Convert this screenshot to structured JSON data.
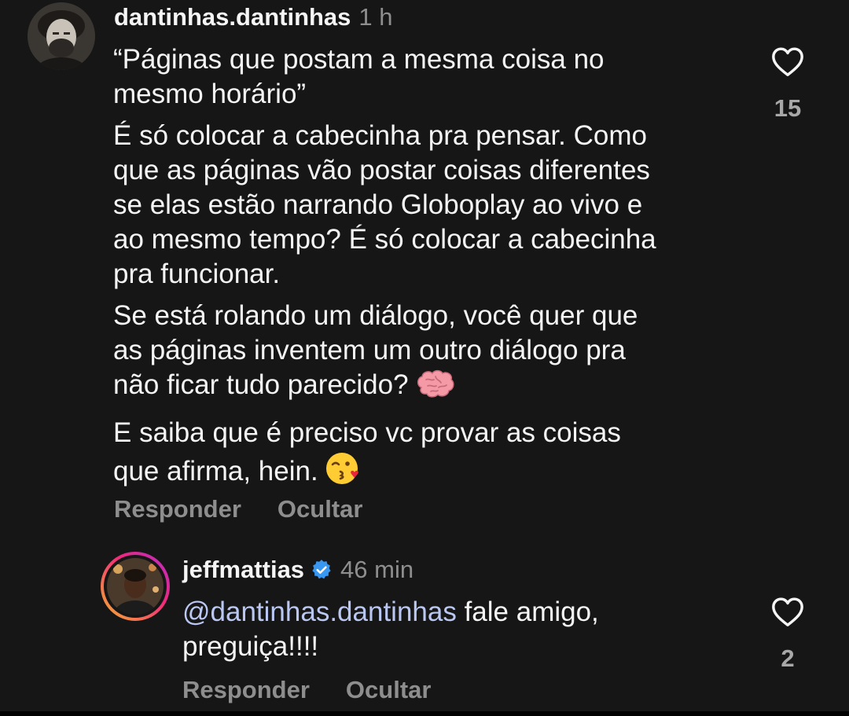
{
  "comments": [
    {
      "username": "dantinhas.dantinhas",
      "time": "1 h",
      "paragraphs": [
        [
          "“Páginas que postam a mesma coisa no",
          "mesmo horário”"
        ],
        [
          "É só colocar a cabecinha pra pensar. Como",
          "que as páginas vão postar coisas diferentes",
          "se elas estão narrando Globoplay ao vivo e",
          "ao mesmo tempo? É só colocar a cabecinha",
          "pra funcionar."
        ],
        [
          "Se está rolando um diálogo, você quer que",
          "as páginas inventem um outro diálogo pra",
          "não ficar tudo parecido?"
        ],
        [
          "E saiba que é preciso vc provar as coisas",
          "que afirma, hein."
        ]
      ],
      "reply_label": "Responder",
      "hide_label": "Ocultar",
      "likes": "15",
      "icon": "heart-outline-icon"
    },
    {
      "username": "jeffmattias",
      "verified": true,
      "time": "46 min",
      "mention": "@dantinhas.dantinhas",
      "text_line1": " fale amigo,",
      "text_line2": "preguiça!!!!",
      "reply_label": "Responder",
      "hide_label": "Ocultar",
      "likes": "2",
      "icon": "heart-outline-icon"
    }
  ],
  "colors": {
    "background": "#161616",
    "text": "#f5f5f5",
    "muted": "#8e8e8e",
    "mention": "#b9c7f2",
    "verified": "#3897f0"
  }
}
